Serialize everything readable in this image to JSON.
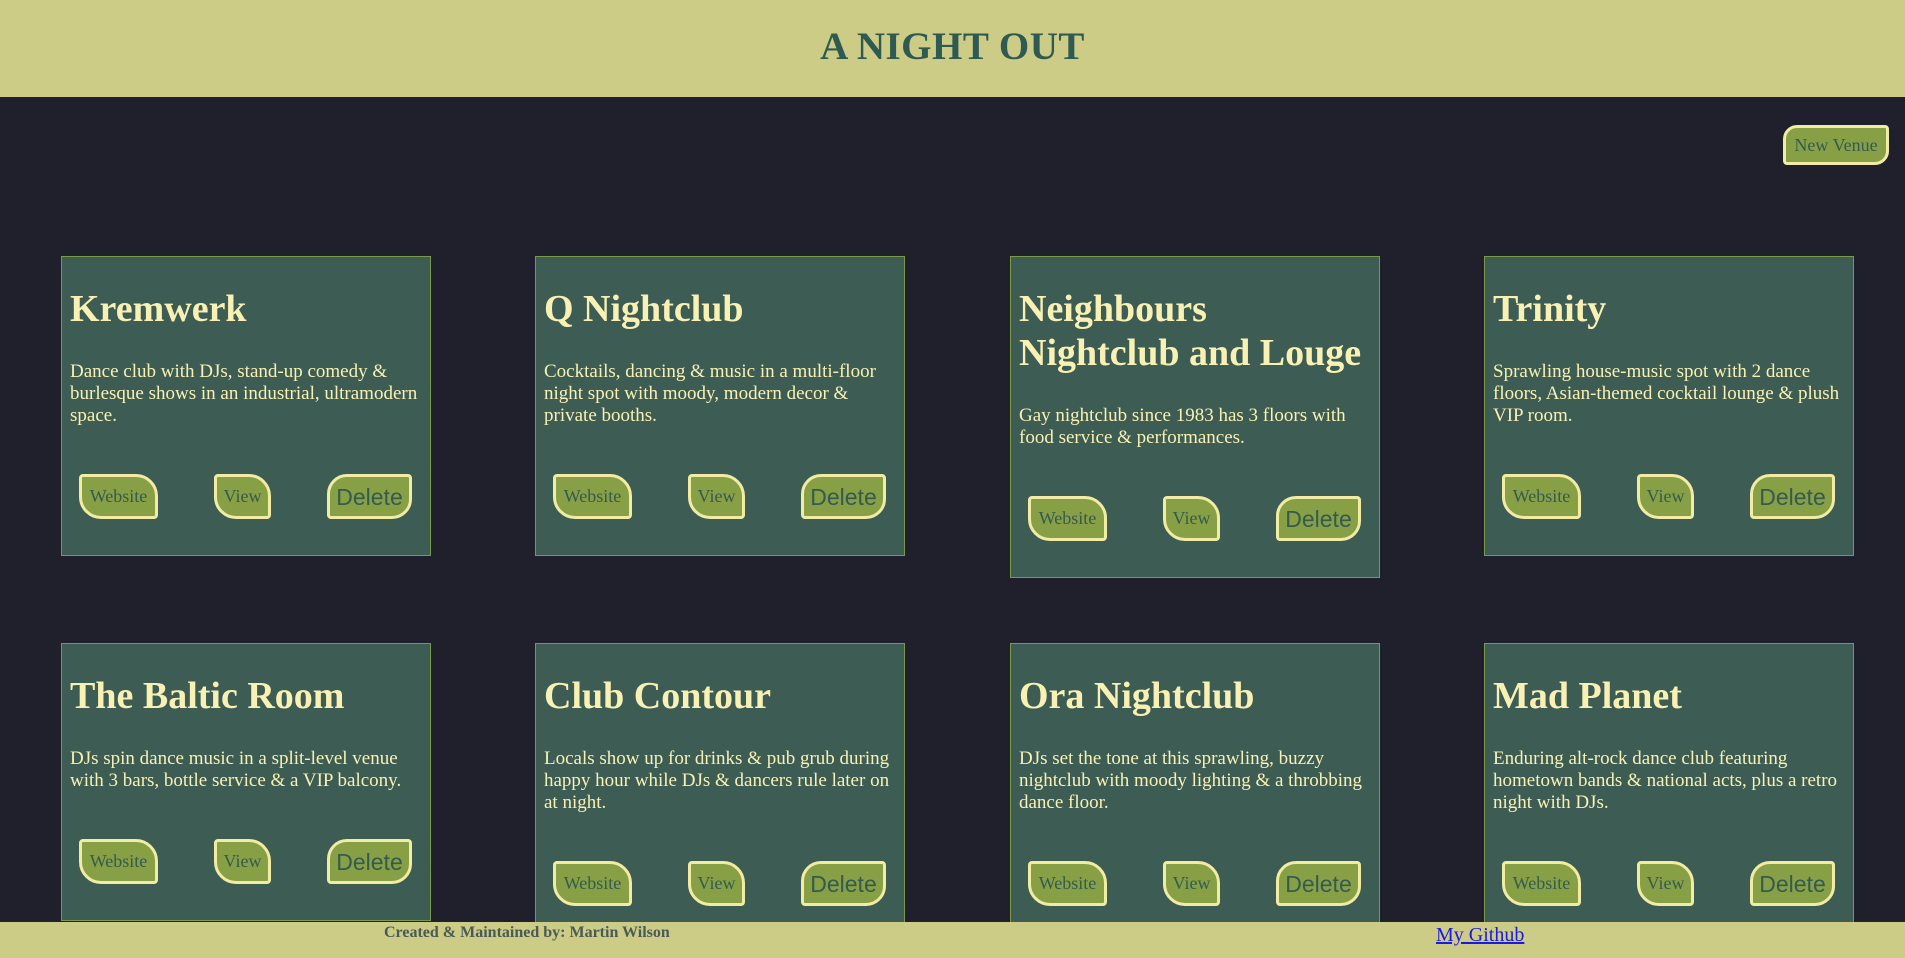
{
  "header": {
    "title": "A NIGHT OUT"
  },
  "toolbar": {
    "new_venue_label": "New Venue"
  },
  "venues": [
    {
      "name": "Kremwerk",
      "description": "Dance club with DJs, stand-up comedy & burlesque shows in an industrial, ultramodern space.",
      "website_label": "Website",
      "view_label": "View",
      "delete_label": "Delete"
    },
    {
      "name": "Q Nightclub",
      "description": "Cocktails, dancing & music in a multi-floor night spot with moody, modern decor & private booths.",
      "website_label": "Website",
      "view_label": "View",
      "delete_label": "Delete"
    },
    {
      "name": "Neighbours Nightclub and Louge",
      "description": "Gay nightclub since 1983 has 3 floors with food service & performances.",
      "website_label": "Website",
      "view_label": "View",
      "delete_label": "Delete"
    },
    {
      "name": "Trinity",
      "description": "Sprawling house-music spot with 2 dance floors, Asian-themed cocktail lounge & plush VIP room.",
      "website_label": "Website",
      "view_label": "View",
      "delete_label": "Delete"
    },
    {
      "name": "The Baltic Room",
      "description": "DJs spin dance music in a split-level venue with 3 bars, bottle service & a VIP balcony.",
      "website_label": "Website",
      "view_label": "View",
      "delete_label": "Delete"
    },
    {
      "name": "Club Contour",
      "description": "Locals show up for drinks & pub grub during happy hour while DJs & dancers rule later on at night.",
      "website_label": "Website",
      "view_label": "View",
      "delete_label": "Delete"
    },
    {
      "name": "Ora Nightclub",
      "description": "DJs set the tone at this sprawling, buzzy nightclub with moody lighting & a throbbing dance floor.",
      "website_label": "Website",
      "view_label": "View",
      "delete_label": "Delete"
    },
    {
      "name": "Mad Planet",
      "description": "Enduring alt-rock dance club featuring hometown bands & national acts, plus a retro night with DJs.",
      "website_label": "Website",
      "view_label": "View",
      "delete_label": "Delete"
    }
  ],
  "footer": {
    "credit": "Created & Maintained by: Martin Wilson",
    "github_label": "My Github"
  },
  "colors": {
    "background": "#1f202b",
    "banner": "#cccc86",
    "card": "#3d5c54",
    "button": "#87a046",
    "text": "#f8f1b3"
  }
}
